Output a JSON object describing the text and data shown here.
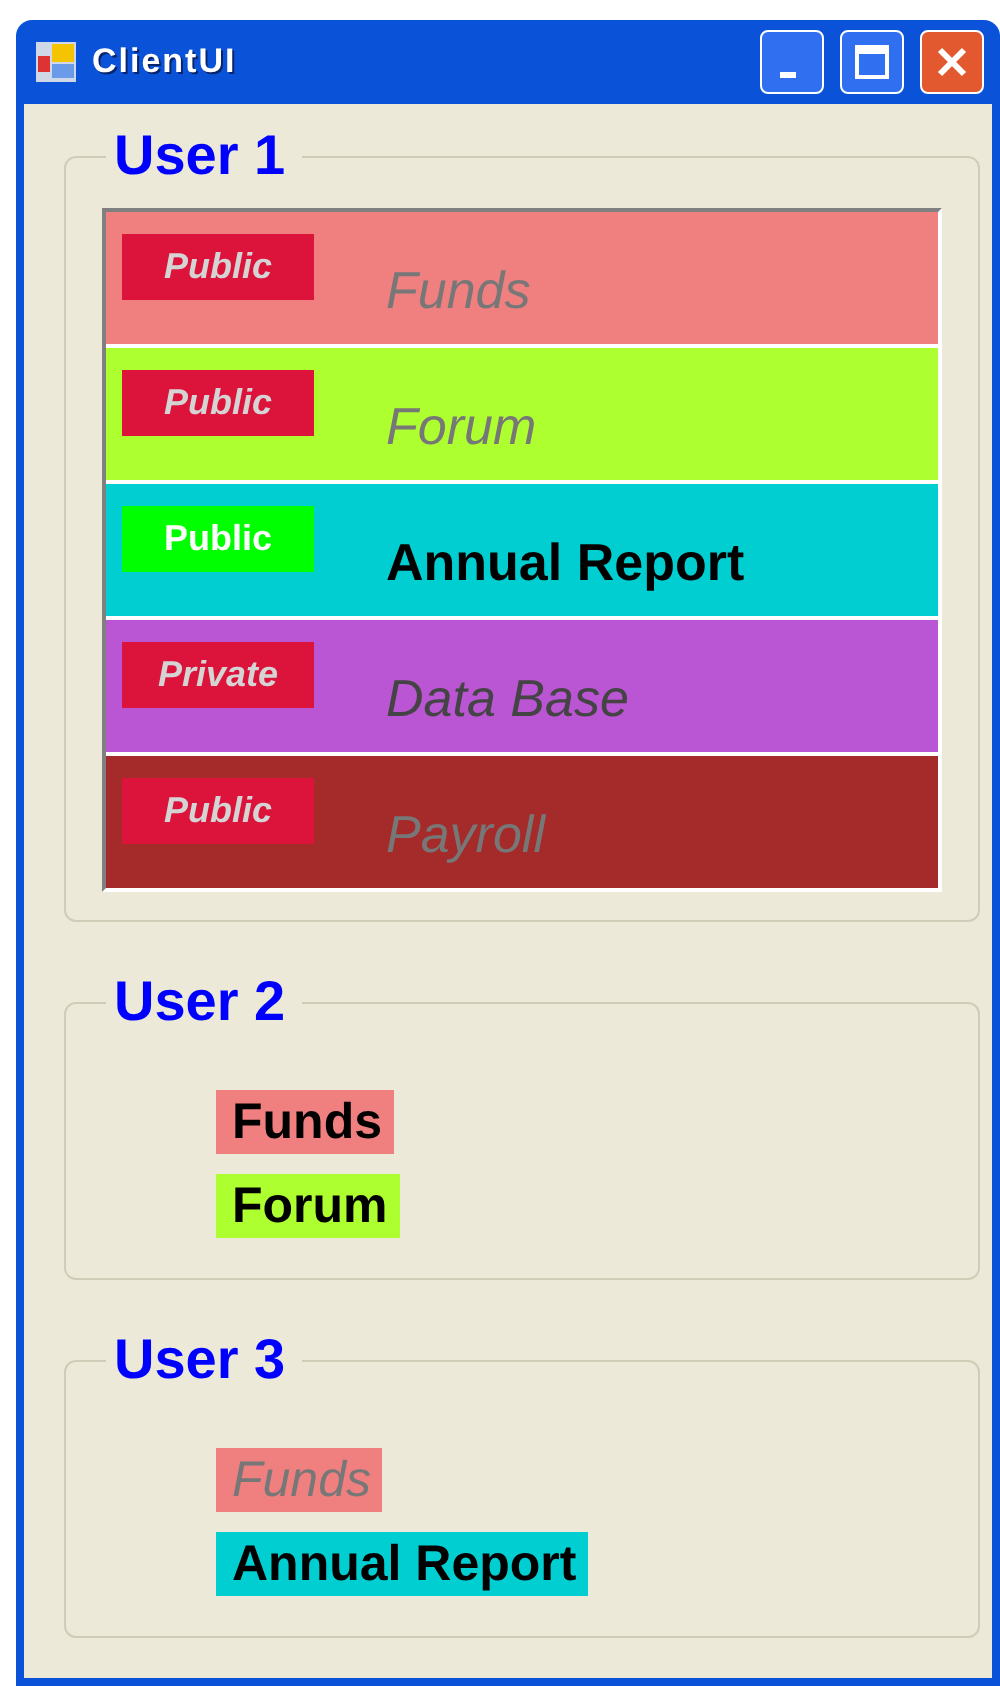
{
  "window": {
    "title": "ClientUI"
  },
  "groups": [
    {
      "title": "User 1",
      "kind": "list",
      "items": [
        {
          "label": "Funds",
          "badge": "Public",
          "color": "#f08080",
          "disabled": true
        },
        {
          "label": "Forum",
          "badge": "Public",
          "color": "#adff2f",
          "disabled": true
        },
        {
          "label": "Annual Report",
          "badge": "Public",
          "color": "#00ced1",
          "disabled": false
        },
        {
          "label": "Data Base",
          "badge": "Private",
          "color": "#ba55d3",
          "disabled": true
        },
        {
          "label": "Payroll",
          "badge": "Public",
          "color": "#a52a2a",
          "disabled": true
        }
      ]
    },
    {
      "title": "User 2",
      "kind": "labels",
      "items": [
        {
          "label": "Funds",
          "color": "#f08080",
          "disabled": false
        },
        {
          "label": "Forum",
          "color": "#adff2f",
          "disabled": false
        }
      ]
    },
    {
      "title": "User 3",
      "kind": "labels",
      "items": [
        {
          "label": "Funds",
          "color": "#f08080",
          "disabled": true
        },
        {
          "label": "Annual Report",
          "color": "#00ced1",
          "disabled": false
        }
      ]
    }
  ]
}
